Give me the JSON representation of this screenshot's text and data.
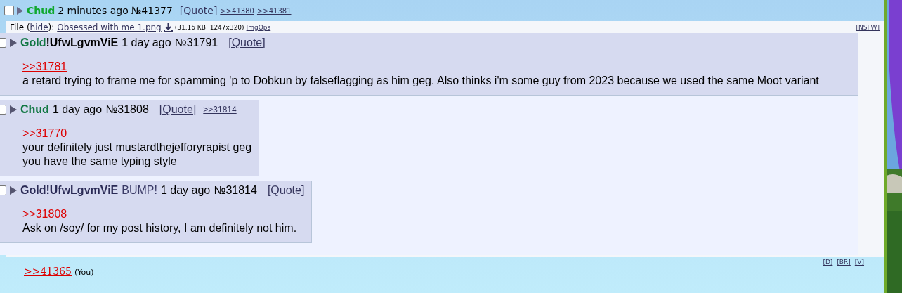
{
  "reply": {
    "checked": false,
    "name": "Chud",
    "time": "2 minutes ago",
    "number": "№41377",
    "quote": "[Quote]",
    "backlinks": [
      ">>41380",
      ">>41381"
    ]
  },
  "file": {
    "prefix": "File (",
    "hide": "hide",
    "suffix": "):",
    "filename": "Obsessed with me 1.png",
    "info": "(31.16 KB, 1247x320)",
    "imgops": "ImgOps",
    "nsfw": "[NSFW]"
  },
  "image_posts": [
    {
      "kind": "wide",
      "checked": false,
      "name": "Gold",
      "color": "#117743",
      "trip": "!UfwLgvmViE",
      "time": "1 day ago",
      "number": "№31791",
      "quote": "[Quote]",
      "reply_to": ">>31781",
      "lines": [
        "a retard trying to frame me for spamming 'p to Dobkun by falseflagging as him geg. Also thinks i'm some guy from 2023 because we used the same Moot variant"
      ]
    },
    {
      "kind": "compact",
      "checked": false,
      "name": "Chud",
      "color": "#117743",
      "time": "1 day ago",
      "number": "№31808",
      "quote": "[Quote]",
      "backlinks": [
        ">>31814"
      ],
      "reply_to": ">>31770",
      "lines": [
        "your definitely just mustardthejefforyrapist geg",
        "you have the same typing style"
      ]
    },
    {
      "kind": "compact",
      "checked": false,
      "name": "Gold",
      "color": "#2a2a55",
      "trip": "!UfwLgvmViE",
      "tag": "BUMP!",
      "time": "1 day ago",
      "number": "№31814",
      "quote": "[Quote]",
      "reply_to": ">>31808",
      "lines": [
        "Ask on /soy/ for my post history, I am definitely not him."
      ]
    }
  ],
  "post_links": [
    "[D]",
    "[BR]",
    "[V]"
  ],
  "quote_link": {
    "text": ">>41365",
    "you": "(You)"
  }
}
